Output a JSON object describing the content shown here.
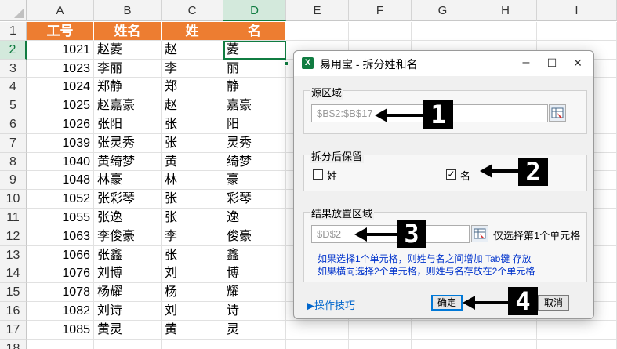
{
  "sheet": {
    "columns": [
      "A",
      "B",
      "C",
      "D",
      "E",
      "F",
      "G",
      "H",
      "I"
    ],
    "selected_column": "D",
    "row_numbers": [
      "1",
      "2",
      "3",
      "4",
      "5",
      "6",
      "7",
      "8",
      "9",
      "10",
      "11",
      "12",
      "13",
      "14",
      "15",
      "16",
      "17",
      "18"
    ],
    "selected_row": "2",
    "header_color": "#ed7d31",
    "headers": [
      "工号",
      "姓名",
      "姓",
      "名"
    ],
    "rows": [
      [
        "1021",
        "赵菱",
        "赵",
        "菱"
      ],
      [
        "1023",
        "李丽",
        "李",
        "丽"
      ],
      [
        "1024",
        "郑静",
        "郑",
        "静"
      ],
      [
        "1025",
        "赵嘉豪",
        "赵",
        "嘉豪"
      ],
      [
        "1026",
        "张阳",
        "张",
        "阳"
      ],
      [
        "1039",
        "张灵秀",
        "张",
        "灵秀"
      ],
      [
        "1040",
        "黄绮梦",
        "黄",
        "绮梦"
      ],
      [
        "1048",
        "林豪",
        "林",
        "豪"
      ],
      [
        "1052",
        "张彩琴",
        "张",
        "彩琴"
      ],
      [
        "1055",
        "张逸",
        "张",
        "逸"
      ],
      [
        "1063",
        "李俊豪",
        "李",
        "俊豪"
      ],
      [
        "1066",
        "张鑫",
        "张",
        "鑫"
      ],
      [
        "1076",
        "刘博",
        "刘",
        "博"
      ],
      [
        "1078",
        "杨耀",
        "杨",
        "耀"
      ],
      [
        "1082",
        "刘诗",
        "刘",
        "诗"
      ],
      [
        "1085",
        "黄灵",
        "黄",
        "灵"
      ]
    ]
  },
  "dialog": {
    "title": "易用宝 - 拆分姓和名",
    "icon": "excel-icon",
    "minimize": "–",
    "maximize": "☐",
    "close": "✕",
    "source": {
      "label": "源区域",
      "value": "$B$2:$B$17"
    },
    "keep": {
      "label": "拆分后保留",
      "surname_label": "姓",
      "surname_checked": false,
      "given_label": "名",
      "given_checked": true,
      "check_mark": "✓"
    },
    "output": {
      "label": "结果放置区域",
      "value": "$D$2",
      "note": "仅选择第1个单元格",
      "hint1": "如果选择1个单元格，则姓与名之间增加 Tab键 存放",
      "hint2": "如果横向选择2个单元格，则姓与名存放在2个单元格"
    },
    "tips_link": "▶操作技巧",
    "ok_label": "确定",
    "cancel_label": "取消"
  },
  "annotations": [
    "1",
    "2",
    "3",
    "4"
  ]
}
